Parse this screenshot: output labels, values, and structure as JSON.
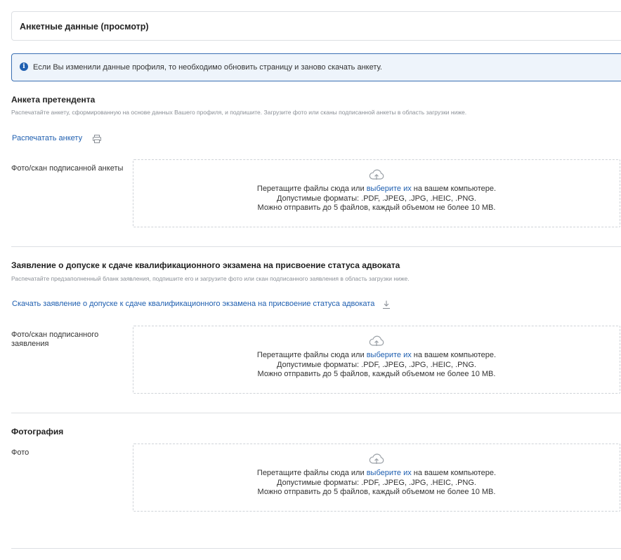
{
  "header": {
    "title": "Анкетные данные (просмотр)"
  },
  "info": {
    "text": "Если Вы изменили данные профиля, то необходимо обновить страницу и заново скачать анкету."
  },
  "dropzone": {
    "line1_before": "Перетащите файлы сюда или ",
    "line1_link": "выберите их",
    "line1_after": " на вашем компьютере.",
    "line2": "Допустимые форматы: .PDF, .JPEG, .JPG, .HEIC, .PNG.",
    "line3": "Можно отправить до 5 файлов, каждый объемом не более 10 МВ."
  },
  "sections": [
    {
      "title": "Анкета претендента",
      "description": "Распечатайте анкету, сформированную на основе данных Вашего профиля, и подпишите. Загрузите фото или сканы подписанной анкеты в область загрузки ниже.",
      "action_label": "Распечатать анкету",
      "action_icon": "printer-icon",
      "field_label": "Фото/скан подписанной анкеты"
    },
    {
      "title": "Заявление о допуске к сдаче квалификационного экзамена на присвоение статуса адвоката",
      "description": "Распечатайте предзаполненный бланк заявления, подпишите его и загрузите фото или скан подписанного заявления в область загрузки ниже.",
      "action_label": "Скачать заявление о допуске к сдаче квалификационного экзамена на присвоение статуса адвоката",
      "action_icon": "download-icon",
      "field_label": "Фото/скан подписанного заявления"
    },
    {
      "title": "Фотография",
      "field_label": "Фото"
    }
  ]
}
